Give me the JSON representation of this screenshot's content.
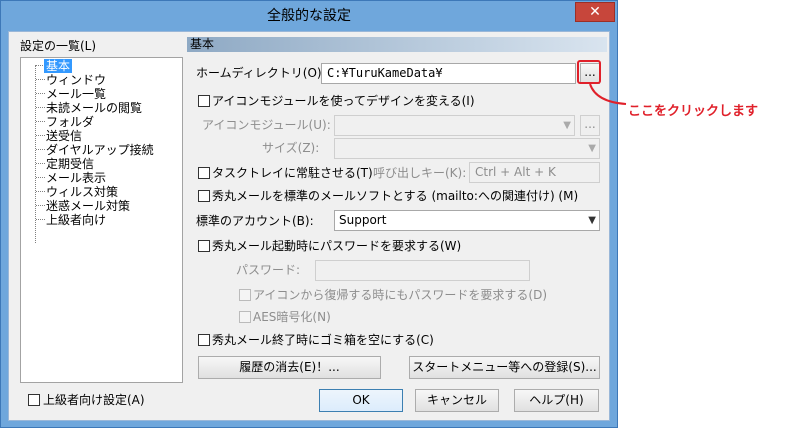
{
  "window": {
    "title": "全般的な設定",
    "close": "✕"
  },
  "sidebar": {
    "header": "設定の一覧(L)",
    "items": [
      "基本",
      "ウィンドウ",
      "メール一覧",
      "未読メールの閲覧",
      "フォルダ",
      "送受信",
      "ダイヤルアップ接続",
      "定期受信",
      "メール表示",
      "ウィルス対策",
      "迷惑メール対策",
      "上級者向け"
    ],
    "advanced_checkbox": "上級者向け設定(A)"
  },
  "section": {
    "title": "基本"
  },
  "form": {
    "home_label": "ホームディレクトリ(O):",
    "home_value": "C:¥TuruKameData¥",
    "browse": "...",
    "icon_module_check": "アイコンモジュールを使ってデザインを変える(I)",
    "icon_module_label": "アイコンモジュール(U):",
    "size_label": "サイズ(Z):",
    "tray_check": "タスクトレイに常駐させる(T)",
    "hotkey_label": "呼び出しキー(K):",
    "hotkey_value": "Ctrl + Alt + K",
    "mailto_check": "秀丸メールを標準のメールソフトとする (mailto:への関連付け) (M)",
    "account_label": "標準のアカウント(B):",
    "account_value": "Support",
    "pw_check": "秀丸メール起動時にパスワードを要求する(W)",
    "pw_label": "パスワード:",
    "pw_restore_check": "アイコンから復帰する時にもパスワードを要求する(D)",
    "aes_check": "AES暗号化(N)",
    "trash_check": "秀丸メール終了時にゴミ箱を空にする(C)",
    "history_button": "履歴の消去(E)！...",
    "startmenu_button": "スタートメニュー等への登録(S)..."
  },
  "buttons": {
    "ok": "OK",
    "cancel": "キャンセル",
    "help": "ヘルプ(H)"
  },
  "annotation": {
    "text": "ここをクリックします",
    "color": "#e0202a"
  }
}
